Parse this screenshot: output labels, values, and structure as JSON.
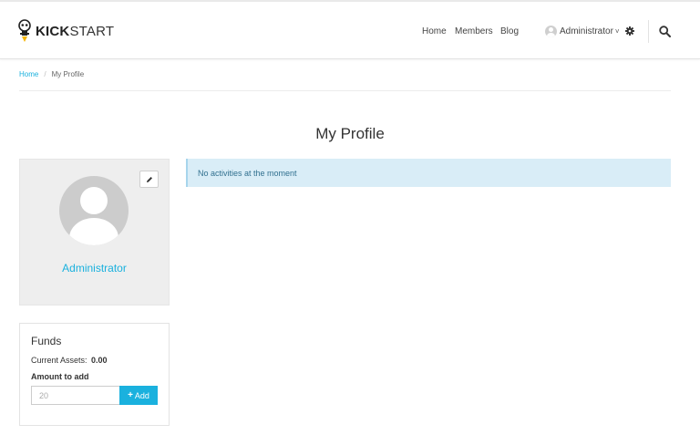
{
  "brand": {
    "logo_bold": "KICK",
    "logo_regular": "START"
  },
  "nav": {
    "home": "Home",
    "members": "Members",
    "blog": "Blog"
  },
  "user_menu": {
    "name": "Administrator",
    "caret": "˅"
  },
  "breadcrumb": {
    "home": "Home",
    "separator": "/",
    "current": "My Profile"
  },
  "page": {
    "title": "My Profile"
  },
  "profile": {
    "name": "Administrator"
  },
  "activities": {
    "empty_message": "No activities at the moment"
  },
  "funds": {
    "title": "Funds",
    "current_assets_label": "Current Assets:",
    "current_assets_value": "0.00",
    "amount_label": "Amount to add",
    "amount_placeholder": "20",
    "add_button_plus": "+",
    "add_button_label": "Add"
  },
  "colors": {
    "accent": "#1ab1de",
    "alert_bg": "#d9edf7",
    "card_bg": "#eeeeee"
  },
  "icons": {
    "logo": "robot-bulb-icon",
    "settings": "gear-icon",
    "search": "search-icon",
    "edit": "pencil-icon",
    "avatar": "user-silhouette-icon"
  }
}
